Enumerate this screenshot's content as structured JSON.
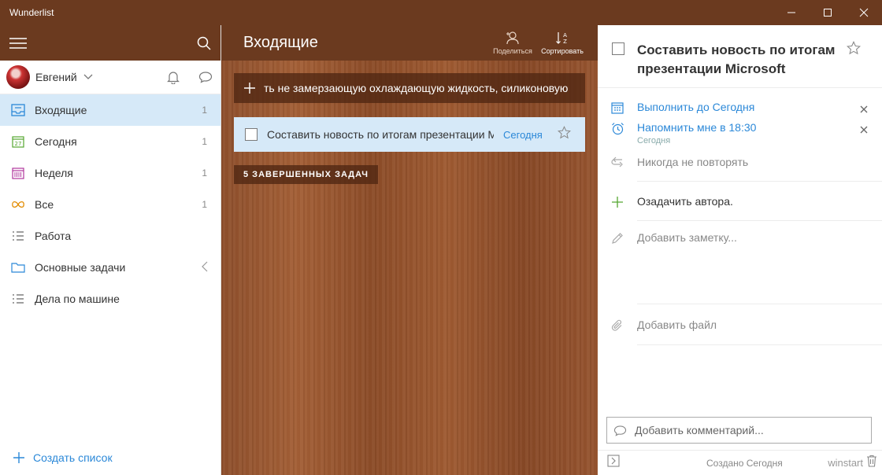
{
  "window": {
    "title": "Wunderlist"
  },
  "sidebar": {
    "user": {
      "name": "Евгений"
    },
    "items": [
      {
        "label": "Входящие",
        "count": "1",
        "icon": "inbox-icon",
        "color": "#2b88d8",
        "active": true
      },
      {
        "label": "Сегодня",
        "count": "1",
        "icon": "calendar-today-icon",
        "color": "#55a630"
      },
      {
        "label": "Неделя",
        "count": "1",
        "icon": "calendar-week-icon",
        "color": "#b0369c"
      },
      {
        "label": "Все",
        "count": "1",
        "icon": "infinity-icon",
        "color": "#e28b00"
      },
      {
        "label": "Работа",
        "count": "",
        "icon": "list-icon",
        "color": "#666666"
      },
      {
        "label": "Основные задачи",
        "count": "",
        "icon": "folder-icon",
        "color": "#2b88d8"
      },
      {
        "label": "Дела по машине",
        "count": "",
        "icon": "list-icon",
        "color": "#666666"
      }
    ],
    "create_list_label": "Создать список"
  },
  "main": {
    "title": "Входящие",
    "share_label": "Поделиться",
    "sort_label": "Сортировать",
    "add_task_text": "ть не замерзающую охлаждающую жидкость, силиконовую",
    "task": {
      "title": "Составить новость по итогам презентации Microsoft",
      "due": "Сегодня"
    },
    "completed_label": "5 ЗАВЕРШЕННЫХ ЗАДАЧ"
  },
  "detail": {
    "title": "Составить новость по итогам презентации Microsoft",
    "due_label": "Выполнить до Сегодня",
    "reminder_label": "Напомнить мне в 18:30",
    "reminder_sub": "Сегодня",
    "repeat_label": "Никогда не повторять",
    "subtask_label": "Озадачить автора.",
    "note_placeholder": "Добавить заметку...",
    "file_label": "Добавить файл",
    "comment_placeholder": "Добавить комментарий...",
    "created_label": "Создано Сегодня",
    "watermark": "winstart"
  },
  "colors": {
    "brand": "#6b3a1f",
    "accent": "#2b88d8",
    "selected": "#d6e9f8"
  }
}
